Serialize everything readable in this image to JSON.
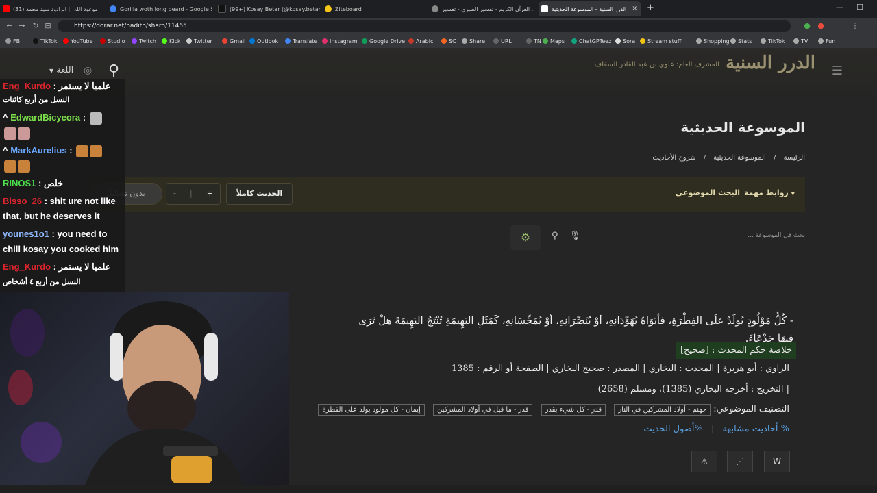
{
  "browser": {
    "tabs": [
      {
        "label": "(31) موعود اللہ || الرادود سيد محمد",
        "icon_color": "#ff0000"
      },
      {
        "label": "Gorilla woth long beard - Google Se...",
        "icon_color": "#4285f4"
      },
      {
        "label": "(99+) Kosay Betar (@kosay.betar) | Ti",
        "icon_color": "#000000"
      },
      {
        "label": "Ziteboard",
        "icon_color": "#f5c518"
      },
      {
        "label": "القرآن الكريم - تفسير الطبري - تفسير ...",
        "icon_color": "#888888"
      },
      {
        "label": "الدرر السنية - الموسوعة الحديثية",
        "icon_color": "#ffffff",
        "active": true
      }
    ],
    "new_tab": "+",
    "url": "https://dorar.net/hadith/sharh/11465",
    "bookmarks": [
      "FB",
      "TikTok",
      "YouTube",
      "Studio",
      "Twitch",
      "Kick",
      "Twitter",
      "Gmail",
      "Outlook",
      "Translate",
      "Instagram",
      "Google Drive",
      "Arabic",
      "SC",
      "Share",
      "URL",
      "TN",
      "Maps",
      "ChatGPTeez",
      "Sora",
      "Stream stuff",
      "Shopping",
      "Stats",
      "TikTok",
      "TV",
      "Fun"
    ]
  },
  "site": {
    "logo": "الدرر السنية",
    "logo_sub": "المشرف العام: علوي بن عبد القادر السقاف",
    "lang_label": "اللغة",
    "page_title": "الموسوعة الحديثية",
    "breadcrumbs": [
      "الرئيسة",
      "الموسوعة الحديثية",
      "شروح الأحاديث"
    ],
    "goldbar": {
      "links": "روابط مهمة",
      "topic_search": "البحث الموضوعي",
      "full_hadith": "الحديث كاملاً",
      "plus": "+",
      "minus": "-",
      "no_tashkeel": "بدون تشكيل"
    },
    "search_placeholder": "بحث في الموسوعة ...",
    "hadith_text": "- كُلُّ مَوْلُودٍ يُولَدُ علَى الفِطْرَةِ، فأبَوَاهُ يُهَوِّدَانِهِ، أوْ يُنَصِّرَانِهِ، أوْ يُمَجِّسَانِهِ، كَمَثَلِ البَهِيمَةِ تُنْتَجُ البَهِيمَةَ هلْ تَرَى فِيهَا جَدْعَاءَ.",
    "verdict": "خلاصة حكم المحدث : [صحيح]",
    "narrator_line": "الراوي : أبو هريرة | المحدث : البخاري | المصدر : صحيح البخاري | الصفحة أو الرقم : 1385",
    "takhrij": "| التخريج : أخرجه البخاري (1385)، ومسلم (2658)",
    "classification_label": "التصنيف الموضوعي:",
    "tags": [
      "جهنم - أولاد المشركين في النار",
      "قدر - كل شيء بقدر",
      "قدر - ما قيل في أولاد المشركين",
      "إيمان - كل مولود يولد على الفطرة"
    ],
    "similar": "% أحاديث مشابهة",
    "origins": "%أصول الحديث"
  },
  "chat": [
    {
      "user": "Eng_Kurdo",
      "color": "#e0242d",
      "text": "علميا لا يستمر",
      "text2": "النسل من أربع كائنات"
    },
    {
      "user": "EdwardBicyeora",
      "color": "#7de04b",
      "text": "",
      "emotes": 3
    },
    {
      "user": "MarkAurelius",
      "color": "#6aa8ff",
      "text": "",
      "emotes": 4
    },
    {
      "user": "RINOS1",
      "color": "#4ce04b",
      "text": "خلص"
    },
    {
      "user": "Bisso_26",
      "color": "#e0242d",
      "text": "shit ure not like",
      "text2": "that, but he deserves it"
    },
    {
      "user": "younes1o1",
      "color": "#8fb8ff",
      "text": "you need to",
      "text2": "chill kosay you cooked him"
    },
    {
      "user": "Eng_Kurdo",
      "color": "#e0242d",
      "text": "علميا لا يستمر",
      "text2": "النسل من أربع ٤ أشخاص"
    }
  ]
}
